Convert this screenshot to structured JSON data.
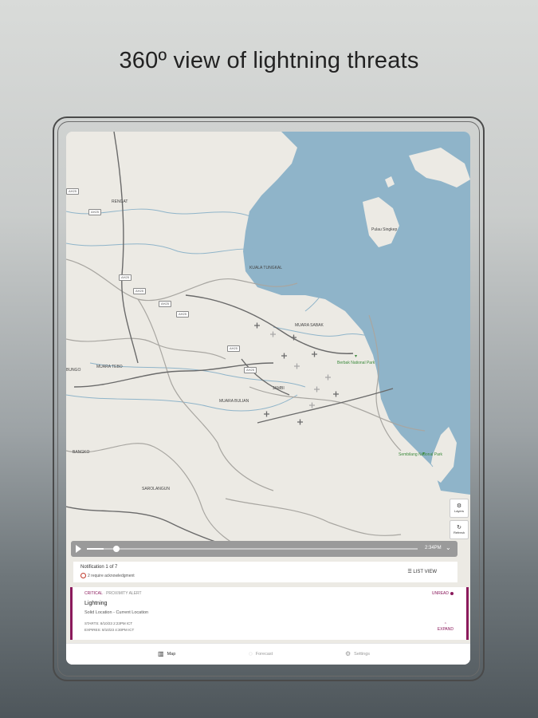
{
  "headline": "360º view of lightning threats",
  "map": {
    "places": {
      "rengat": "RENGAT",
      "kuala_tungkal": "KUALA TUNGKAL",
      "muara_sabak": "MUARA SABAK",
      "muara_tebo": "MUARA TEBO",
      "jambi": "JAMBI",
      "muara_bulian": "MUARA BULIAN",
      "bungo": "BUNGO",
      "bangko": "BANGKO",
      "sarolangun": "SAROLANGUN",
      "pulau_singkep": "Pulau Singkep",
      "berbak": "Berbak National Park",
      "sembilang": "Sembilang National Park"
    },
    "roads": {
      "r1": "AH25",
      "r2": "AH25",
      "r3": "AH25",
      "r4": "AH25",
      "r5": "AH25",
      "r6": "AH25",
      "r7": "AH25",
      "r8": "AH25"
    },
    "controls": {
      "layers_label": "Layers",
      "refresh_label": "Refresh"
    }
  },
  "playback": {
    "time": "2:34PM",
    "progress": 0.05
  },
  "notification": {
    "count_text": "Notification 1 of 7",
    "ack_text": "2 require acknowledgment",
    "list_view": "LIST VIEW"
  },
  "alert": {
    "level": "CRITICAL",
    "kind": "PROXIMITY ALERT",
    "status": "UNREAD",
    "title": "Lightning",
    "subtitle": "Solid Location - Current Location",
    "start": "STARTS: 8/10/23 2:23PM ICT",
    "expires": "EXPIRES: 8/10/23 4:30PM ICT",
    "expand": "EXPAND"
  },
  "tabs": {
    "map": "Map",
    "forecast": "Forecast",
    "settings": "Settings"
  },
  "colors": {
    "accent": "#8b1a5c",
    "water": "#8fb4c9",
    "land": "#eceae4"
  }
}
